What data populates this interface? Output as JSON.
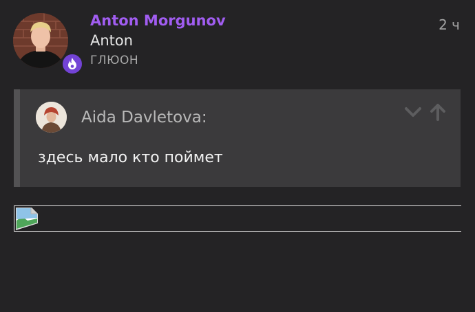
{
  "post": {
    "author_name": "Anton Morgunov",
    "author_nick": "Anton",
    "author_title": "ГЛЮОН",
    "date": "2 ч",
    "flair_icon": "flame-icon",
    "quote": {
      "author": "Aida Davletova:",
      "text": "здесь мало кто поймет",
      "controls": [
        "chevron-down-icon",
        "arrow-up-icon"
      ]
    },
    "image_icon": "broken-image-icon"
  },
  "colors": {
    "background": "#242325",
    "name_accent": "#a15df1",
    "flair": "#7343d6",
    "quote_bg": "#3b3a3c"
  }
}
